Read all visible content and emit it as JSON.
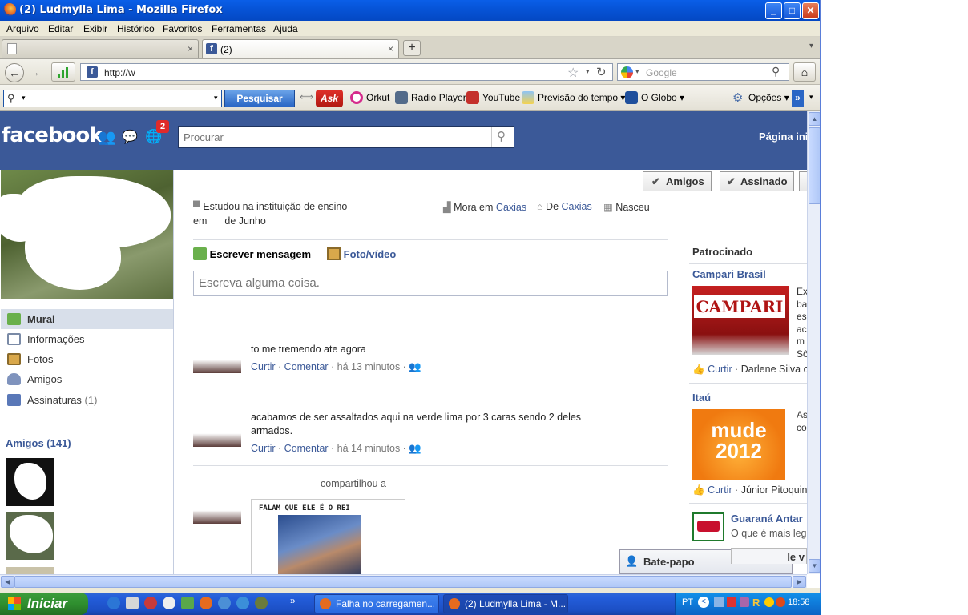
{
  "window": {
    "title": "(2) Ludmylla Lima - Mozilla Firefox",
    "min": "_",
    "max": "□",
    "close": "✕"
  },
  "menu": [
    "Arquivo",
    "Editar",
    "Exibir",
    "Histórico",
    "Favoritos",
    "Ferramentas",
    "Ajuda"
  ],
  "tabs": [
    {
      "label": "",
      "close": "×"
    },
    {
      "label": "(2)",
      "close": "×"
    }
  ],
  "nav": {
    "back": "←",
    "forward": "→",
    "url": "http://w",
    "search_placeholder": "Google",
    "home": "⌂",
    "star": "☆",
    "reload": "↻"
  },
  "toolbar": {
    "search_button": "Pesquisar",
    "ask": "Ask",
    "items": [
      "Orkut",
      "Radio Player",
      "YouTube",
      "Previsão do tempo ▾",
      "O Globo ▾"
    ],
    "options": "Opções ▾",
    "more": "»"
  },
  "facebook": {
    "logo": "facebook",
    "notif_count": "2",
    "search_placeholder": "Procurar",
    "home_link": "Página ini",
    "buttons": {
      "friends": "Amigos",
      "subscribed": "Assinado"
    },
    "info": {
      "studied": "Estudou na instituição de ensino",
      "lives_prefix": "Mora em",
      "lives_city": "Caxias",
      "from_prefix": "De",
      "from_city": "Caxias",
      "born": "Nasceu",
      "born_line2_a": "em",
      "born_line2_b": "de Junho"
    },
    "composer": {
      "write": "Escrever mensagem",
      "photo": "Foto/vídeo",
      "placeholder": "Escreva alguma coisa."
    },
    "left_nav": [
      {
        "label": "Mural"
      },
      {
        "label": "Informações"
      },
      {
        "label": "Fotos"
      },
      {
        "label": "Amigos"
      },
      {
        "label": "Assinaturas",
        "count": "(1)"
      }
    ],
    "friends_header": "Amigos (141)",
    "posts": [
      {
        "text": "to me tremendo ate agora",
        "like": "Curtir",
        "comment": "Comentar",
        "time": "há 13 minutos"
      },
      {
        "text": "acabamos de ser assaltados aqui na verde lima por 3 caras sendo 2 deles armados.",
        "like": "Curtir",
        "comment": "Comentar",
        "time": "há 14 minutos"
      },
      {
        "text": "compartilhou a",
        "image_caption": "FALAM QUE ELE É O REI"
      }
    ],
    "sponsored": {
      "title": "Patrocinado",
      "ads": [
        {
          "name": "Campari Brasil",
          "image_text": "CAMPARI",
          "snippet": [
            "Ex",
            "ba",
            "es",
            "ac",
            "m",
            "Sô"
          ],
          "like": "Curtir",
          "liker": "Darlene Silva c"
        },
        {
          "name": "Itaú",
          "image_text_1": "mude",
          "image_text_2": "2012",
          "snippet": [
            "As",
            "co"
          ],
          "like": "Curtir",
          "liker": "Júnior Pitoquin"
        },
        {
          "name": "Guaraná Antar",
          "snippet": "O que é mais leg"
        }
      ]
    },
    "chat": {
      "label": "Bate-papo",
      "extra": "le v"
    }
  },
  "taskbar": {
    "start": "Iniciar",
    "chevrons": "»",
    "items": [
      {
        "label": "Falha no carregamen..."
      },
      {
        "label": "(2) Ludmylla Lima - M..."
      }
    ],
    "lang": "PT",
    "clock": "18:58"
  }
}
